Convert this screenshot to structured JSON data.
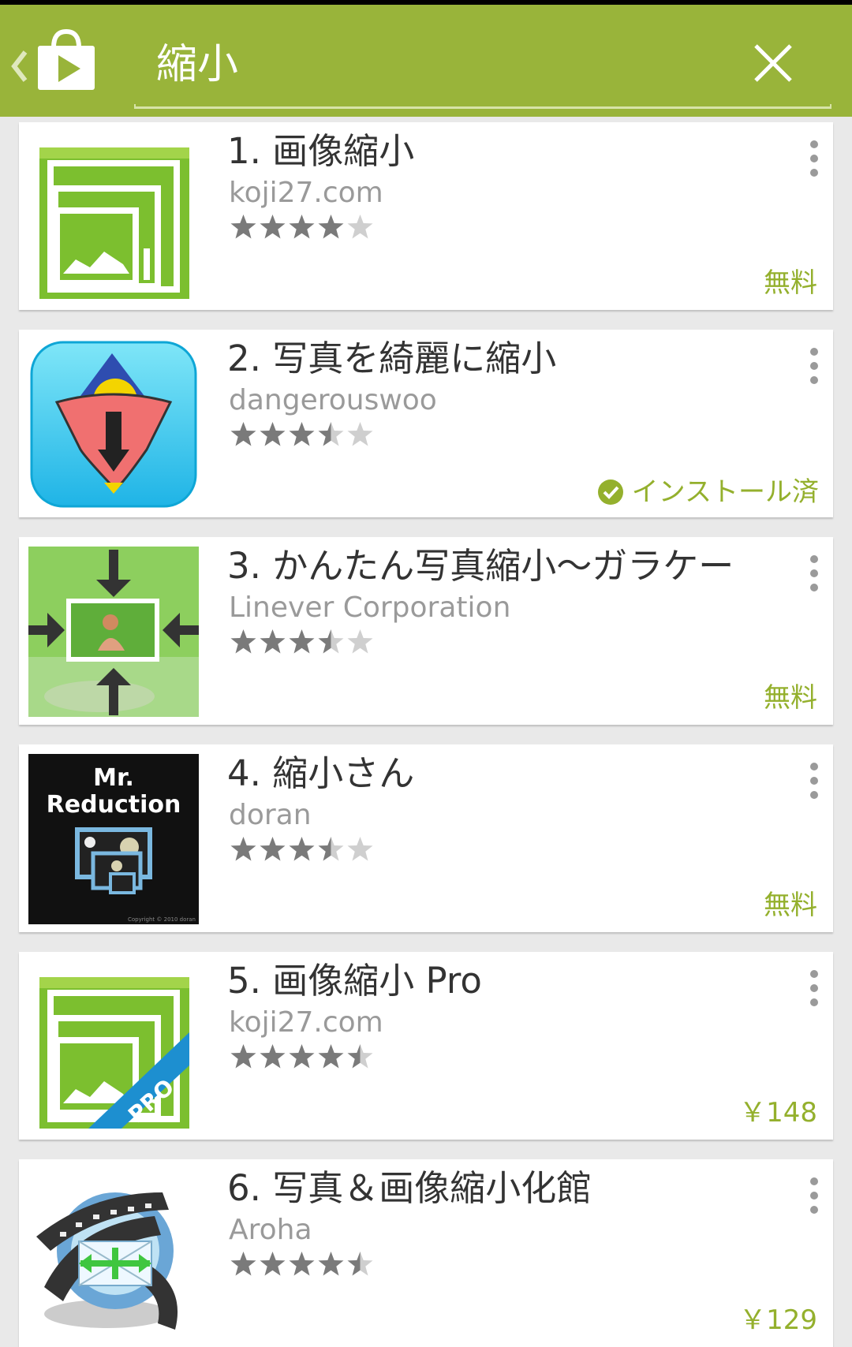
{
  "header": {
    "search_query": "縮小",
    "icons": [
      "back-icon",
      "play-store-icon",
      "close-icon"
    ]
  },
  "colors": {
    "actionbar": "#99b43a",
    "price_green": "#94b02d",
    "star_filled": "#7a7a7a",
    "star_empty": "#cfcfcf"
  },
  "apps": [
    {
      "title": "1. 画像縮小",
      "developer": "koji27.com",
      "rating": 4.0,
      "price": "無料",
      "installed": false
    },
    {
      "title": "2. 写真を綺麗に縮小",
      "developer": "dangerouswoo",
      "rating": 3.5,
      "price": "",
      "installed": true,
      "installed_label": "インストール済"
    },
    {
      "title": "3. かんたん写真縮小～ガラケー",
      "developer": "Linever Corporation",
      "rating": 3.5,
      "price": "無料",
      "installed": false
    },
    {
      "title": "4. 縮小さん",
      "developer": "doran",
      "rating": 3.5,
      "price": "無料",
      "installed": false,
      "icon_text": [
        "Mr.",
        "Reduction"
      ],
      "icon_copyright": "Copyright © 2010 doran"
    },
    {
      "title": "5. 画像縮小 Pro",
      "developer": "koji27.com",
      "rating": 4.5,
      "price": "￥148",
      "installed": false,
      "icon_badge": "PRO"
    },
    {
      "title": "6. 写真＆画像縮小化館",
      "developer": "Aroha",
      "rating": 4.5,
      "price": "￥129",
      "installed": false
    }
  ]
}
